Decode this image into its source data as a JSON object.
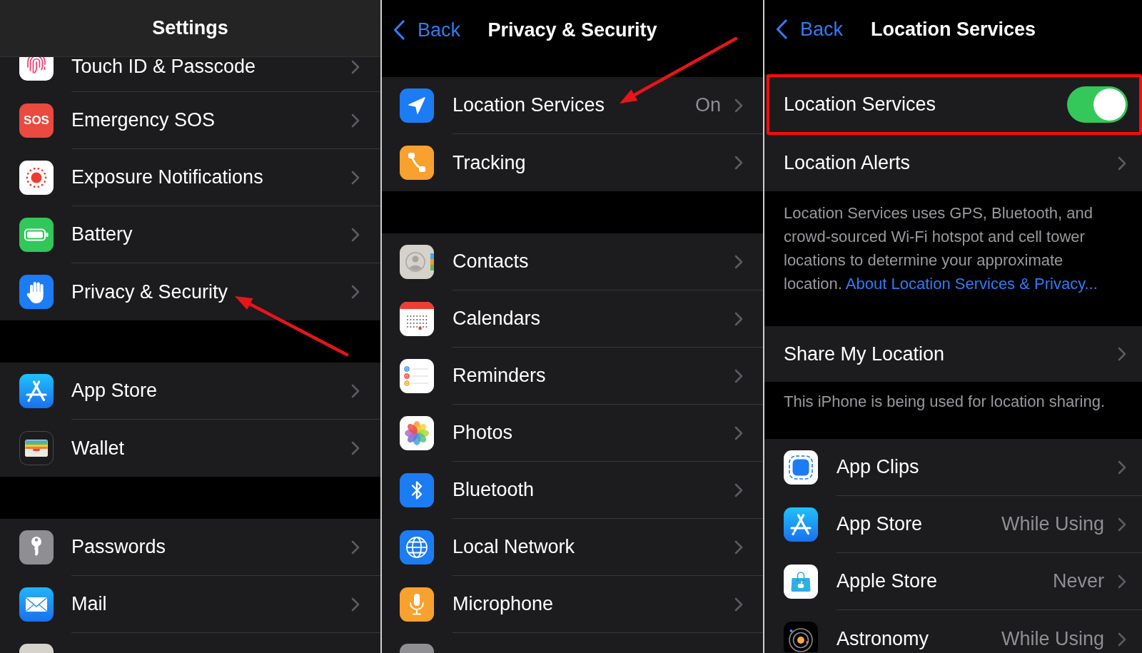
{
  "settings_panel": {
    "title": "Settings",
    "groups": [
      {
        "items": [
          {
            "label": "Touch ID & Passcode",
            "pointed_at": false
          },
          {
            "label": "Emergency SOS",
            "icon_text": "SOS",
            "pointed_at": false
          },
          {
            "label": "Exposure Notifications",
            "pointed_at": false
          },
          {
            "label": "Battery",
            "pointed_at": false
          },
          {
            "label": "Privacy & Security",
            "pointed_at": true
          }
        ]
      },
      {
        "items": [
          {
            "label": "App Store",
            "pointed_at": false
          },
          {
            "label": "Wallet",
            "pointed_at": false
          }
        ]
      },
      {
        "items": [
          {
            "label": "Passwords",
            "pointed_at": false
          },
          {
            "label": "Mail",
            "pointed_at": false
          }
        ]
      }
    ]
  },
  "privacy_panel": {
    "back": "Back",
    "title": "Privacy & Security",
    "groups": [
      {
        "items": [
          {
            "label": "Location Services",
            "value": "On",
            "pointed_at": true
          },
          {
            "label": "Tracking",
            "pointed_at": false
          }
        ]
      },
      {
        "items": [
          {
            "label": "Contacts",
            "pointed_at": false
          },
          {
            "label": "Calendars",
            "pointed_at": false
          },
          {
            "label": "Reminders",
            "pointed_at": false
          },
          {
            "label": "Photos",
            "pointed_at": false
          },
          {
            "label": "Bluetooth",
            "pointed_at": false
          },
          {
            "label": "Local Network",
            "pointed_at": false
          },
          {
            "label": "Microphone",
            "pointed_at": false
          }
        ]
      }
    ]
  },
  "location_panel": {
    "back": "Back",
    "title": "Location Services",
    "toggle_row": {
      "label": "Location Services",
      "on": true,
      "highlighted": true
    },
    "alerts_row": {
      "label": "Location Alerts"
    },
    "description": {
      "text": "Location Services uses GPS, Bluetooth, and crowd-sourced Wi-Fi hotspot and cell tower locations to determine your approximate location.",
      "link": "About Location Services & Privacy..."
    },
    "share_row": {
      "label": "Share My Location"
    },
    "share_note": "This iPhone is being used for location sharing.",
    "apps": [
      {
        "label": "App Clips"
      },
      {
        "label": "App Store",
        "value": "While Using"
      },
      {
        "label": "Apple Store",
        "value": "Never"
      },
      {
        "label": "Astronomy",
        "value": "While Using"
      }
    ]
  }
}
